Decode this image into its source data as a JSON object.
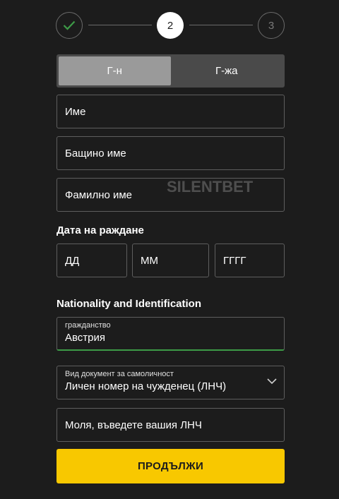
{
  "stepper": {
    "step2_number": "2",
    "step3_number": "3"
  },
  "gender": {
    "mr_label": "Г-н",
    "mrs_label": "Г-жа",
    "selected": "Г-н"
  },
  "fields": {
    "first_name_placeholder": "Име",
    "middle_name_placeholder": "Бащино име",
    "last_name_placeholder": "Фамилно име"
  },
  "dob": {
    "label": "Дата на раждане",
    "day_placeholder": "ДД",
    "month_placeholder": "ММ",
    "year_placeholder": "ГГГГ"
  },
  "nationality": {
    "heading": "Nationality and Identification",
    "citizenship_label": "гражданство",
    "citizenship_value": "Австрия",
    "doc_type_label": "Вид документ за самоличност",
    "doc_type_value": "Личен номер на чужденец (ЛНЧ)",
    "lnch_placeholder": "Моля, въведете вашия ЛНЧ"
  },
  "submit_label": "ПРОДЪЛЖИ",
  "watermark": "SILENTBET",
  "colors": {
    "background": "#1c1c1c",
    "accent": "#f8c800",
    "success": "#3d9b47"
  }
}
